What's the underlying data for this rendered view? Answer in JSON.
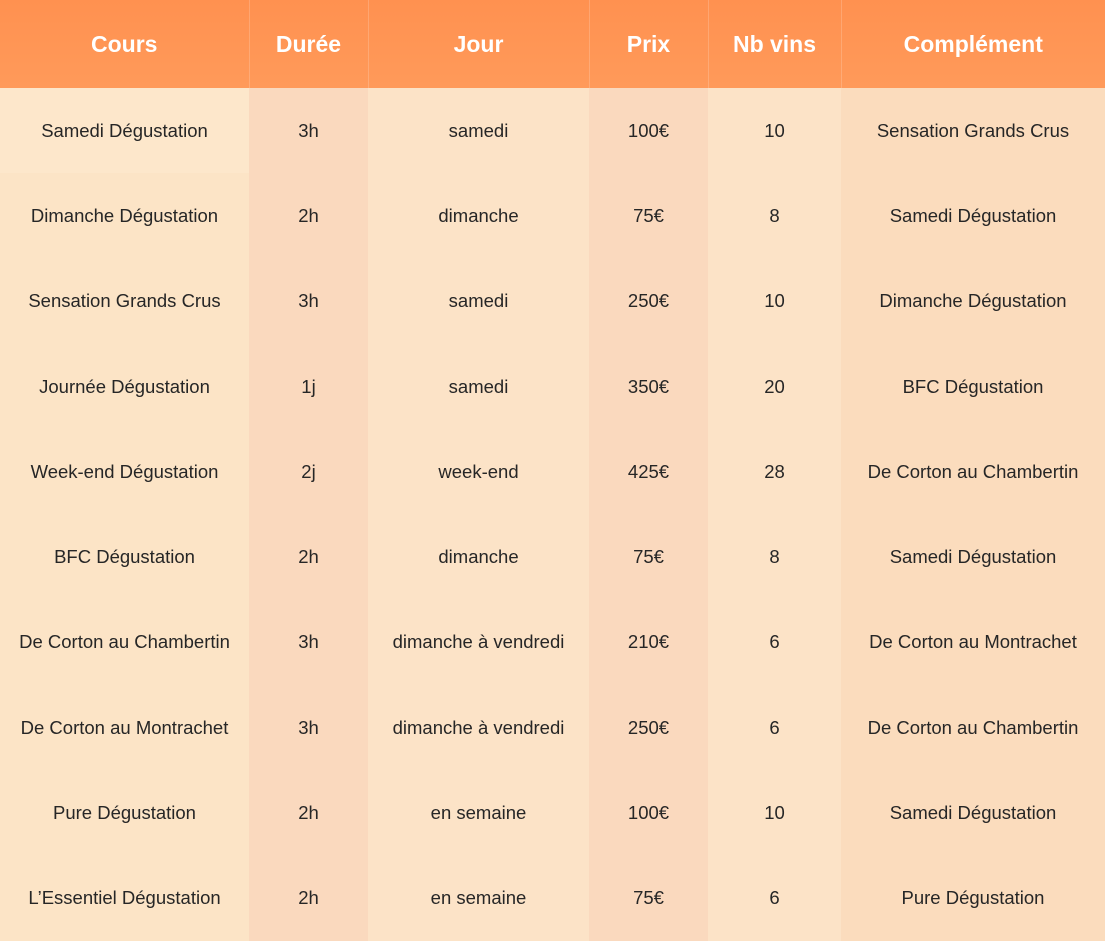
{
  "table": {
    "headers": [
      "Cours",
      "Durée",
      "Jour",
      "Prix",
      "Nb vins",
      "Complément"
    ],
    "rows": [
      [
        "Samedi Dégustation",
        "3h",
        "samedi",
        "100€",
        "10",
        "Sensation Grands Crus"
      ],
      [
        "Dimanche Dégustation",
        "2h",
        "dimanche",
        "75€",
        "8",
        "Samedi Dégustation"
      ],
      [
        "Sensation Grands Crus",
        "3h",
        "samedi",
        "250€",
        "10",
        "Dimanche Dégustation"
      ],
      [
        "Journée Dégustation",
        "1j",
        "samedi",
        "350€",
        "20",
        "BFC Dégustation"
      ],
      [
        "Week-end Dégustation",
        "2j",
        "week-end",
        "425€",
        "28",
        "De Corton au Chambertin"
      ],
      [
        "BFC Dégustation",
        "2h",
        "dimanche",
        "75€",
        "8",
        "Samedi Dégustation"
      ],
      [
        "De Corton au Chambertin",
        "3h",
        "dimanche à vendredi",
        "210€",
        "6",
        "De Corton au Montrachet"
      ],
      [
        "De Corton au Montrachet",
        "3h",
        "dimanche à vendredi",
        "250€",
        "6",
        "De Corton au Chambertin"
      ],
      [
        "Pure Dégustation",
        "2h",
        "en semaine",
        "100€",
        "10",
        "Samedi Dégustation"
      ],
      [
        "L’Essentiel Dégustation",
        "2h",
        "en semaine",
        "75€",
        "6",
        "Pure Dégustation"
      ]
    ]
  },
  "colors": {
    "header_background": "#ff9150",
    "header_text": "#ffffff",
    "body_background": "#fce3c7",
    "body_text": "#262626"
  }
}
